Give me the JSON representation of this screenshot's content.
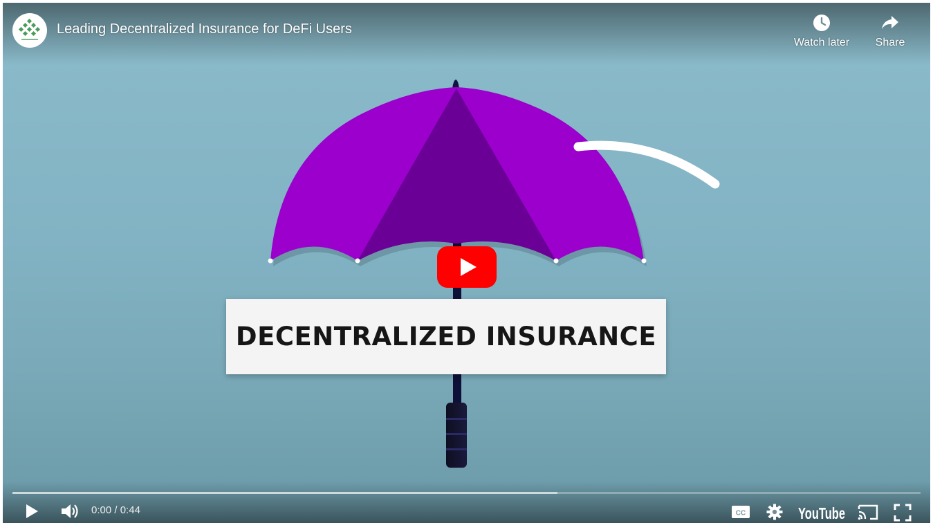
{
  "video": {
    "title": "Leading Decentralized Insurance for DeFi Users",
    "banner_text": "DECENTRALIZED INSURANCE",
    "current_time": "0:00",
    "duration": "0:44",
    "buffered_fraction": 0.6
  },
  "actions": {
    "watch_later": "Watch later",
    "share": "Share"
  },
  "controls": {
    "time_separator": "/",
    "play_icon": "play-icon",
    "volume_icon": "volume-icon",
    "captions_icon": "cc-icon",
    "settings_icon": "gear-icon",
    "youtube_logo": "YouTube",
    "cast_icon": "cast-icon",
    "fullscreen_icon": "fullscreen-icon"
  },
  "colors": {
    "background": "#82b3c4",
    "umbrella_purple": "#9b00cc",
    "umbrella_dark": "#6a0096",
    "play_button": "#ff0000",
    "logo_green": "#4a9c5a"
  }
}
